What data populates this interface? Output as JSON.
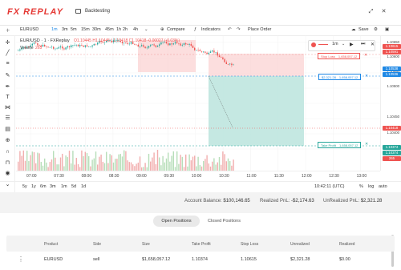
{
  "app": {
    "logo": "FX REPLAY",
    "section": "Backtesting"
  },
  "symbol_bar": {
    "symbol": "EURUSD",
    "timeframes": [
      "1m",
      "3m",
      "5m",
      "15m",
      "30m",
      "45m",
      "1h",
      "2h",
      "4h"
    ],
    "active_timeframe": "1m",
    "compare": "Compare",
    "indicators": "Indicators",
    "place_order": "Place Order",
    "save": "Save"
  },
  "legend": {
    "title": "EUR/USD · 1 · FXReplay",
    "ohlc": "O1.10445 H1.10445 L1.10418 C1.10418 -0.00027 (-0.03%)",
    "volume_label": "Volume",
    "volume_value": "265"
  },
  "replay": {
    "speed": "1m"
  },
  "orders": {
    "stop_loss": {
      "label": "Stop Loss",
      "amount": "1,658,057.12"
    },
    "entry": {
      "label": "$2,321.28",
      "amount": "1,658,057.12"
    },
    "take_profit": {
      "label": "Take Profit",
      "amount": "1,658,057.12"
    }
  },
  "price_axis": {
    "labels": [
      "1.10650",
      "1.10600",
      "1.10550",
      "1.10500",
      "1.10450",
      "1.10400",
      "1.10350"
    ],
    "badges": [
      {
        "text": "1.10615",
        "color": "#ef5350"
      },
      {
        "text": "1.10591",
        "color": "#ef5350"
      },
      {
        "text": "1.10538",
        "color": "#1e88e5"
      },
      {
        "text": "1.10536",
        "color": "#1e88e5"
      },
      {
        "text": "1.10418",
        "color": "#ef5350"
      },
      {
        "text": "1.10374",
        "color": "#26a69a"
      },
      {
        "text": "1.10374",
        "color": "#26a69a"
      },
      {
        "text": "265",
        "color": "#ef5350"
      }
    ]
  },
  "time_axis": {
    "labels": [
      "07:00",
      "07:30",
      "08:00",
      "08:30",
      "09:00",
      "09:30",
      "10:00",
      "10:30",
      "11:00",
      "11:30",
      "12:00",
      "12:30",
      "13:00"
    ],
    "cursor_time": "10:42:11 (UTC)"
  },
  "ranges": [
    "5y",
    "1y",
    "6m",
    "3m",
    "1m",
    "5d",
    "1d"
  ],
  "axis_opts": [
    "%",
    "log",
    "auto"
  ],
  "account": {
    "balance_label": "Account Balance:",
    "balance": "$100,146.65",
    "realized_label": "Realized PnL:",
    "realized": "-$2,174.63",
    "unrealized_label": "UnRealized PnL:",
    "unrealized": "$2,321.28"
  },
  "tabs": {
    "open": "Open Positions",
    "closed": "Closed Positions"
  },
  "table": {
    "columns": [
      "Product",
      "Side",
      "Size",
      "Take Profit",
      "Stop Loss",
      "Unrealized",
      "Realized"
    ],
    "rows": [
      [
        "EURUSD",
        "sell",
        "$1,658,057.12",
        "1.10374",
        "1.10615",
        "$2,321.28",
        "$0.00"
      ]
    ]
  },
  "colors": {
    "up": "#26a69a",
    "down": "#ef5350",
    "accent": "#1e88e5",
    "brand": "#e53935"
  },
  "chart_data": {
    "type": "candlestick",
    "x": [
      "07:00",
      "07:30",
      "08:00",
      "08:30",
      "09:00",
      "09:30",
      "10:00",
      "10:30",
      "11:00"
    ],
    "close": [
      1.1064,
      1.1064,
      1.1062,
      1.1063,
      1.1062,
      1.1061,
      1.1055,
      1.10418,
      null
    ]
  }
}
